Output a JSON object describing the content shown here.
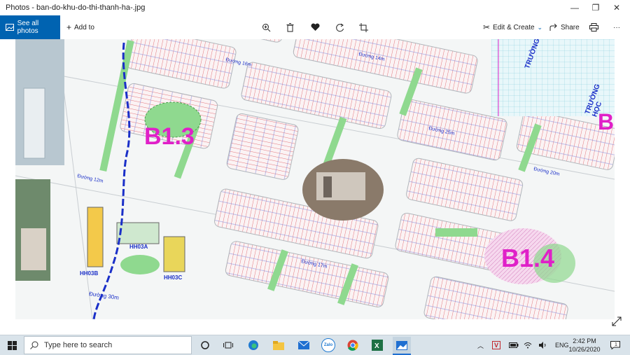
{
  "window": {
    "title": "Photos - ban-do-khu-do-thi-thanh-ha-.jpg",
    "minimize": "—",
    "maximize": "❐",
    "close": "✕"
  },
  "toolbar": {
    "see_all_photos": "See all photos",
    "add_to": "Add to",
    "edit_create": "Edit & Create",
    "share": "Share",
    "more": "···"
  },
  "map": {
    "block_labels": [
      "B1.3",
      "B1.4",
      "B"
    ],
    "building_labels": [
      "HH03B",
      "HH03A",
      "HH03C"
    ],
    "school_labels": [
      "TRƯỜNG HỌC",
      "TRƯỜNG HỌC"
    ],
    "road_labels": [
      "Đường 30m",
      "Đường 25m",
      "Đường 14m",
      "Đường 12m",
      "Đường 17m",
      "Đường 20m",
      "Đường 16m"
    ],
    "colors": {
      "block_label": "#e020c8",
      "road_blue": "#1a2fc8",
      "park_green": "#8fd98f",
      "lot_red": "#d9404a"
    }
  },
  "taskbar": {
    "search_placeholder": "Type here to search",
    "zalo_label": "Zalo",
    "language": "ENG",
    "time": "2:42 PM",
    "date": "10/26/2020",
    "notifications": "1"
  }
}
